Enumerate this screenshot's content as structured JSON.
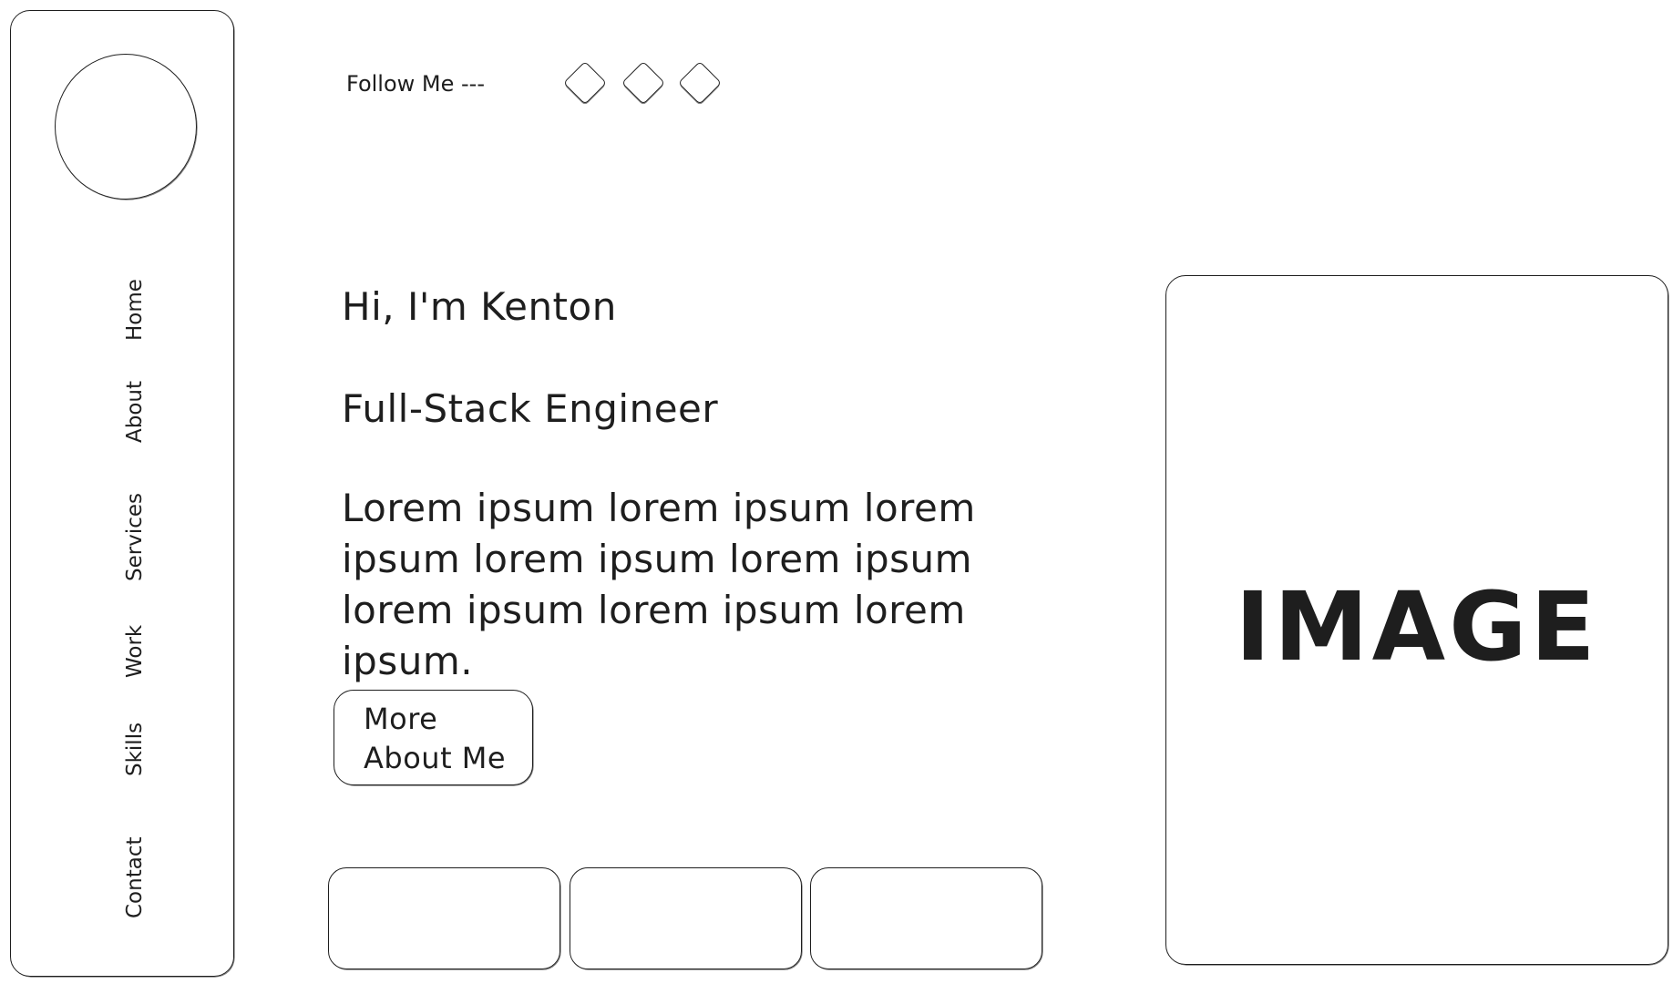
{
  "sidebar": {
    "nav_items": [
      {
        "label": "Home"
      },
      {
        "label": "About"
      },
      {
        "label": "Services"
      },
      {
        "label": "Work"
      },
      {
        "label": "Skills"
      },
      {
        "label": "Contact"
      }
    ]
  },
  "header": {
    "follow_label": "Follow Me ---",
    "social_icons": [
      "social-icon-1",
      "social-icon-2",
      "social-icon-3"
    ]
  },
  "hero": {
    "greeting": "Hi, I'm Kenton",
    "title": "Full-Stack Engineer",
    "body": "Lorem ipsum lorem ipsum lorem ipsum lorem ipsum lorem ipsum lorem ipsum lorem ipsum lorem ipsum.",
    "button_label_line1": "More",
    "button_label_line2": "About Me"
  },
  "image_placeholder": {
    "label": "IMAGE"
  },
  "colors": {
    "stroke": "#1e1e1e",
    "background": "#ffffff"
  }
}
